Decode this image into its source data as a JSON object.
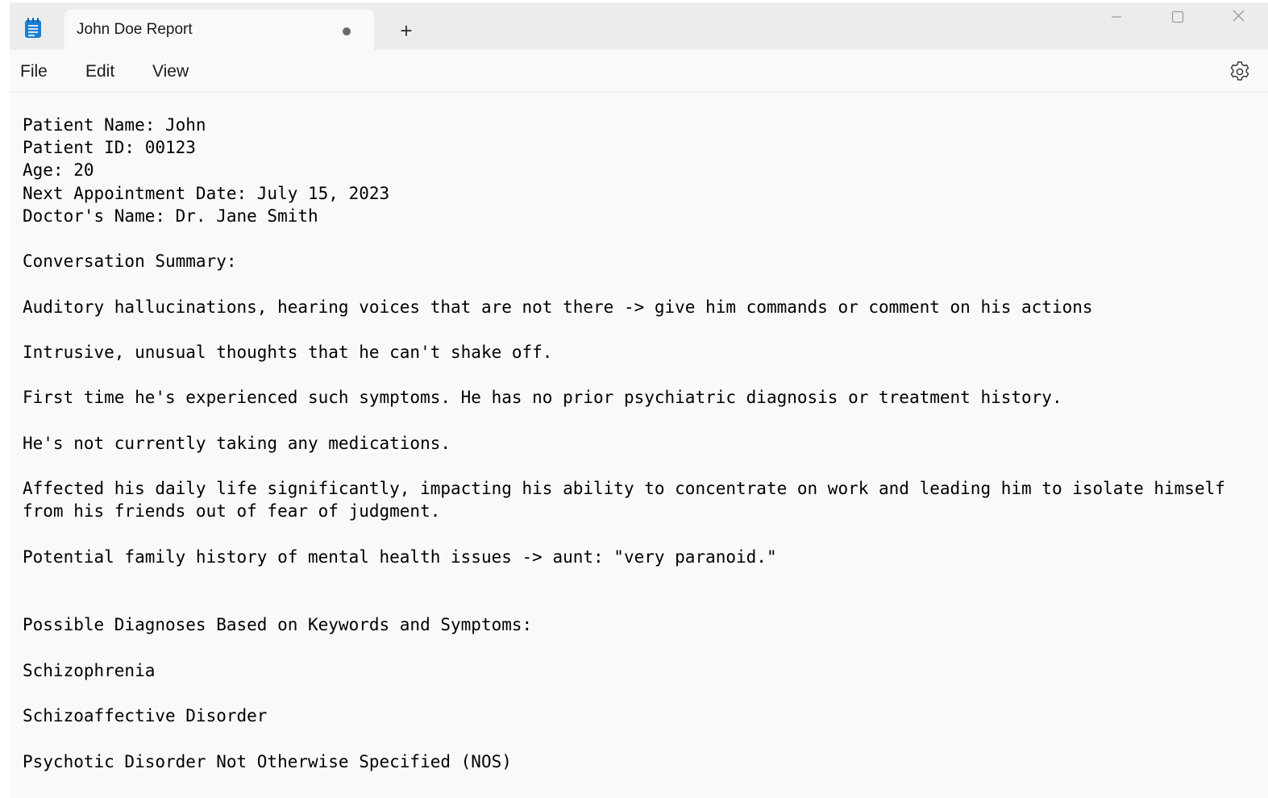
{
  "window": {
    "tab_title": "John Doe Report",
    "new_tab_label": "+"
  },
  "menu": {
    "file": "File",
    "edit": "Edit",
    "view": "View"
  },
  "icons": {
    "app": "notepad-icon",
    "unsaved": "unsaved-dot-icon",
    "minimize": "minimize-icon",
    "maximize": "maximize-icon",
    "close": "close-icon",
    "settings": "gear-icon"
  },
  "colors": {
    "app_icon": "#1a7fd4",
    "editor_bg": "#f9f9f9",
    "titlebar_bg": "#ececec"
  },
  "editor": {
    "content": "Patient Name: John\nPatient ID: 00123\nAge: 20\nNext Appointment Date: July 15, 2023\nDoctor's Name: Dr. Jane Smith\n\nConversation Summary:\n\nAuditory hallucinations, hearing voices that are not there -> give him commands or comment on his actions\n\nIntrusive, unusual thoughts that he can't shake off.\n\nFirst time he's experienced such symptoms. He has no prior psychiatric diagnosis or treatment history.\n\nHe's not currently taking any medications.\n\nAffected his daily life significantly, impacting his ability to concentrate on work and leading him to isolate himself\nfrom his friends out of fear of judgment.\n\nPotential family history of mental health issues -> aunt: \"very paranoid.\"\n\n\nPossible Diagnoses Based on Keywords and Symptoms:\n\nSchizophrenia\n\nSchizoaffective Disorder\n\nPsychotic Disorder Not Otherwise Specified (NOS)"
  }
}
